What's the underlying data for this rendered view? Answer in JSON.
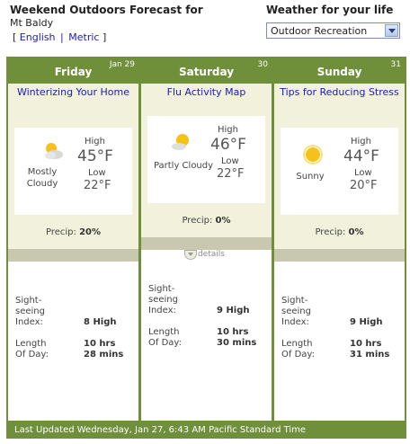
{
  "header": {
    "title": "Weekend Outdoors Forecast for",
    "location": "Mt Baldy",
    "units": {
      "open": "[",
      "english": "English",
      "sep": "|",
      "metric": "Metric",
      "close": "]"
    }
  },
  "sidebar": {
    "title": "Weather for your life",
    "select_value": "Outdoor Recreation"
  },
  "labels": {
    "high": "High",
    "low": "Low",
    "precip": "Precip:",
    "sightseeing_1": "Sight-",
    "sightseeing_2": "seeing",
    "sightseeing_3": "Index:",
    "length_1": "Length",
    "length_2": "Of Day:",
    "details": "details"
  },
  "days": [
    {
      "name": "Friday",
      "date": "Jan 29",
      "link": "Winterizing Your Home",
      "condition": "Mostly Cloudy",
      "icon": "partly-sunny-icon",
      "high": "45°F",
      "low": "22°F",
      "precip": "20%",
      "sightseeing": "8 High",
      "length_hrs": "10 hrs",
      "length_mins": "28 mins"
    },
    {
      "name": "Saturday",
      "date": "30",
      "link": "Flu Activity Map",
      "condition": "Partly Cloudy",
      "icon": "partly-cloudy-icon",
      "high": "46°F",
      "low": "22°F",
      "precip": "0%",
      "sightseeing": "9 High",
      "length_hrs": "10 hrs",
      "length_mins": "30 mins"
    },
    {
      "name": "Sunday",
      "date": "31",
      "link": "Tips for Reducing Stress",
      "condition": "Sunny",
      "icon": "sun-icon",
      "high": "44°F",
      "low": "20°F",
      "precip": "0%",
      "sightseeing": "9 High",
      "length_hrs": "10 hrs",
      "length_mins": "31 mins"
    }
  ],
  "footer": {
    "updated": "Last Updated Wednesday, Jan 27, 6:43 AM Pacific Standard Time"
  },
  "colors": {
    "header_green": "#6f8f3b",
    "panel_cream": "#f1f1dc",
    "link_blue": "#1a1ab8",
    "stripe": "#c8c8b0"
  }
}
